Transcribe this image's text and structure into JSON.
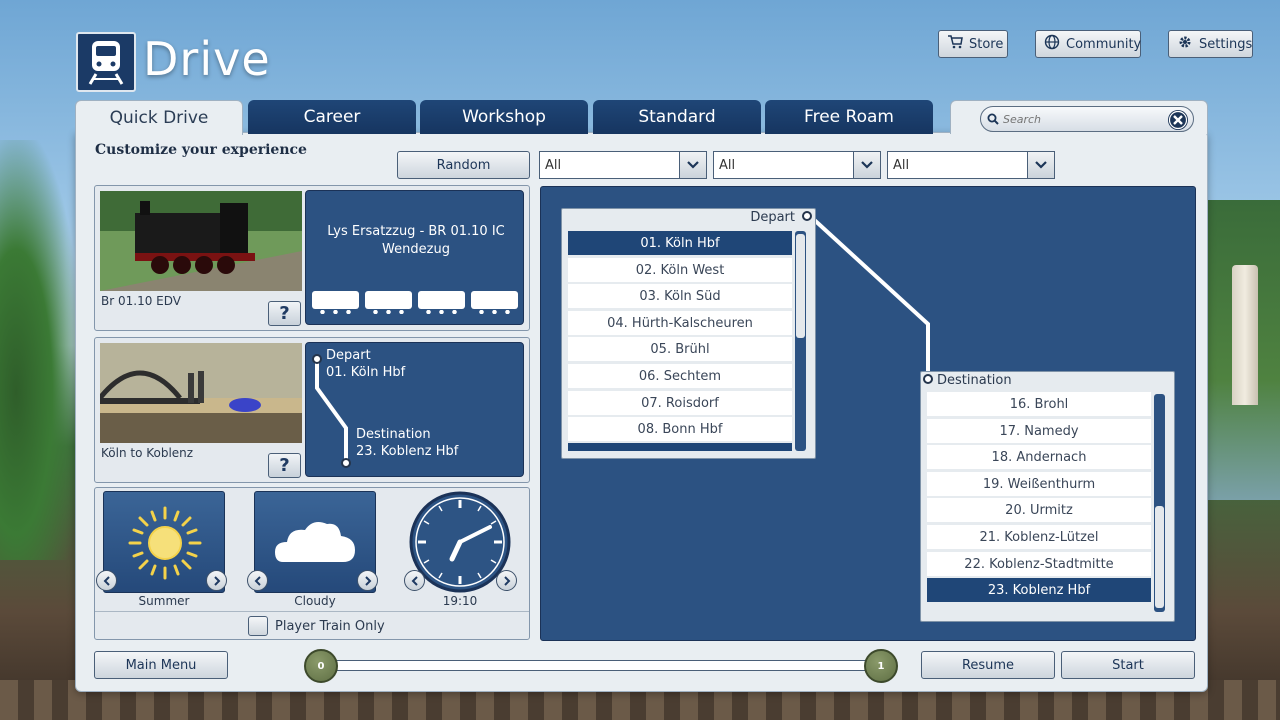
{
  "app": {
    "title": "Drive"
  },
  "top_buttons": [
    {
      "label": "Store",
      "icon": "cart-icon"
    },
    {
      "label": "Community",
      "icon": "globe-icon"
    },
    {
      "label": "Settings",
      "icon": "gear-icon"
    }
  ],
  "tabs": [
    {
      "label": "Quick Drive",
      "active": true
    },
    {
      "label": "Career",
      "active": false
    },
    {
      "label": "Workshop",
      "active": false
    },
    {
      "label": "Standard",
      "active": false
    },
    {
      "label": "Free Roam",
      "active": false
    }
  ],
  "search": {
    "placeholder": "Search"
  },
  "filters": {
    "heading": "Customize your experience",
    "random_label": "Random",
    "dropdowns": [
      "All",
      "All",
      "All"
    ]
  },
  "train": {
    "photo_label": "Br 01.10 EDV",
    "consist_name": "Lys Ersatzzug - BR 01.10 IC Wendezug",
    "help_label": "?"
  },
  "route": {
    "photo_label": "Köln to Koblenz",
    "depart_label": "Depart",
    "depart_station": "01. Köln Hbf",
    "destination_label": "Destination",
    "destination_station": "23. Koblenz Hbf",
    "help_label": "?"
  },
  "conditions": {
    "season": "Summer",
    "weather": "Cloudy",
    "time": "19:10",
    "player_train_only": "Player Train Only"
  },
  "depart_list": {
    "header": "Depart",
    "items": [
      "01. Köln Hbf",
      "02. Köln West",
      "03. Köln Süd",
      "04. Hürth-Kalscheuren",
      "05. Brühl",
      "06. Sechtem",
      "07. Roisdorf",
      "08. Bonn Hbf"
    ],
    "selected_index": 0
  },
  "destination_list": {
    "header": "Destination",
    "items": [
      "16. Brohl",
      "17. Namedy",
      "18. Andernach",
      "19. Weißenthurm",
      "20. Urmitz",
      "21. Koblenz-Lützel",
      "22. Koblenz-Stadtmitte",
      "23. Koblenz Hbf"
    ],
    "selected_index": 7
  },
  "footer": {
    "main_menu": "Main Menu",
    "resume": "Resume",
    "start": "Start",
    "slider_min": "0",
    "slider_max": "1"
  },
  "colors": {
    "accent_navy": "#1f4677",
    "panel_blue": "#2c5282",
    "panel_bg": "#e9eef2"
  }
}
